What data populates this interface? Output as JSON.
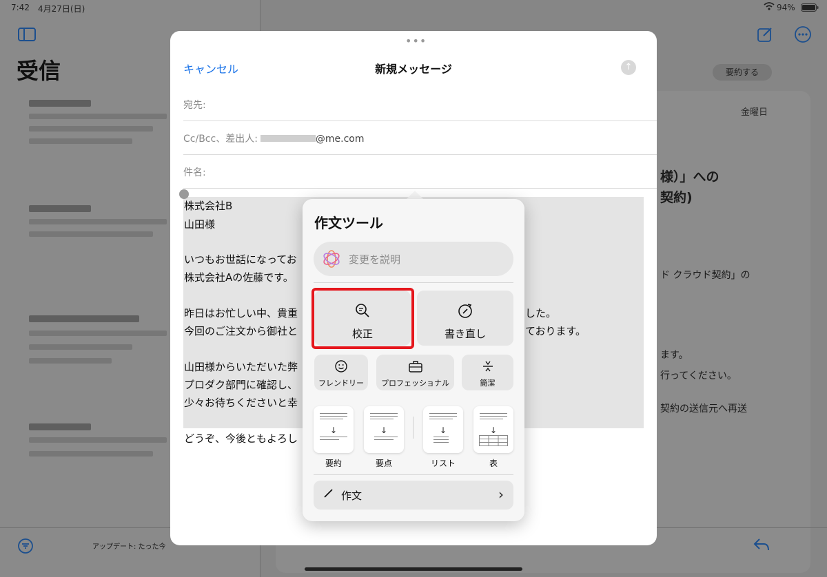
{
  "status_bar": {
    "time": "7:42",
    "date": "4月27日(日)",
    "battery": "94%"
  },
  "sidebar": {
    "title": "受信",
    "footer_update": "アップデート: たった今"
  },
  "detail": {
    "summarize_button": "要約する",
    "date": "金曜日",
    "subject_line1": "様）」への",
    "subject_line2": "契約)",
    "text_fragments": [
      "ド クラウド契約」の",
      "ます。",
      "行ってください。",
      "契約の送信元へ再送"
    ]
  },
  "compose": {
    "cancel_label": "キャンセル",
    "title": "新規メッセージ",
    "to_label": "宛先:",
    "cc_label": "Cc/Bcc、差出人:",
    "from_suffix": "@me.com",
    "subject_label": "件名:",
    "body_lines": [
      "株式会社B",
      "山田様",
      "",
      "いつもお世話になってお",
      "株式会社Aの佐藤です。",
      "",
      "昨日はお忙しい中、貴重",
      "今回のご注文から御社と",
      "",
      "山田様からいただいた弊",
      "プロダク部門に確認し、",
      "少々お待ちくださいと幸",
      "",
      "どうぞ、今後ともよろし"
    ],
    "body_right_fragments": [
      "した。",
      "ております。"
    ]
  },
  "writing_tools": {
    "title": "作文ツール",
    "describe_placeholder": "変更を説明",
    "proofread_label": "校正",
    "rewrite_label": "書き直し",
    "friendly_label": "フレンドリー",
    "professional_label": "プロフェッショナル",
    "concise_label": "簡潔",
    "summary_label": "要約",
    "keypoints_label": "要点",
    "list_label": "リスト",
    "table_label": "表",
    "compose_label": "作文"
  },
  "colors": {
    "accent": "#1a73e8",
    "highlight": "#e5161c"
  }
}
